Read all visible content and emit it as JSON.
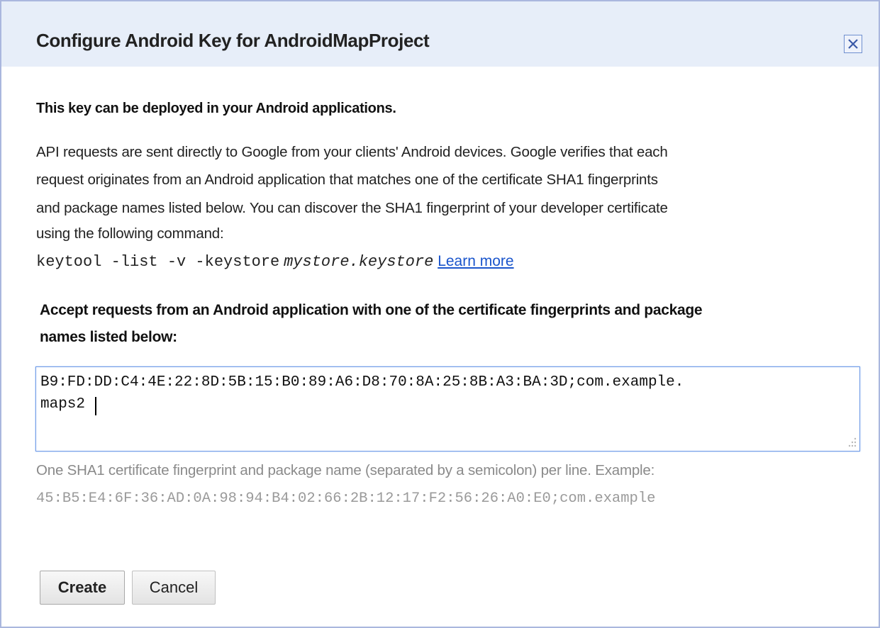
{
  "dialog": {
    "title": "Configure Android Key for AndroidMapProject",
    "close_icon": "close-icon"
  },
  "intro": {
    "heading": "This key can be deployed in your Android applications.",
    "description_lines": [
      "API requests are sent directly to Google from your clients' Android devices. Google verifies that each",
      "request originates from an Android application that matches one of the certificate SHA1 fingerprints",
      "and package names listed below. You can discover the SHA1 fingerprint of your developer certificate",
      "using the following command:"
    ],
    "command": "keytool -list -v -keystore",
    "command_arg": "mystore.keystore",
    "learn_more_label": "Learn more"
  },
  "accept": {
    "heading_lines": [
      "Accept requests from an Android application with one of the certificate fingerprints and package",
      "names listed below:"
    ]
  },
  "fingerprints_field": {
    "value_lines": [
      "B9:FD:DD:C4:4E:22:8D:5B:15:B0:89:A6:D8:70:8A:25:8B:A3:BA:3D;com.example.",
      "maps2"
    ]
  },
  "hint": {
    "text": "One SHA1 certificate fingerprint and package name (separated by a semicolon) per line. Example:",
    "example": "45:B5:E4:6F:36:AD:0A:98:94:B4:02:66:2B:12:17:F2:56:26:A0:E0;com.example"
  },
  "buttons": {
    "create_label": "Create",
    "cancel_label": "Cancel"
  },
  "colors": {
    "title_bar_bg": "#e7eef9",
    "dialog_border": "#aab7de",
    "link": "#1a55cc",
    "field_focus_border": "#6f9ae6",
    "hint_text": "#8a8a8a"
  }
}
